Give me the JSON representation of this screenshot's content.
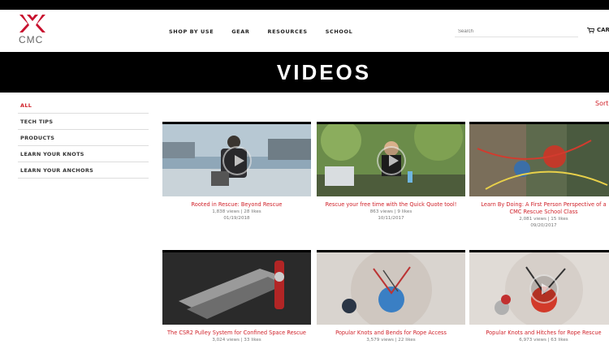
{
  "brand": {
    "logo_text": "CMC"
  },
  "nav": {
    "items": [
      "SHOP BY USE",
      "GEAR",
      "RESOURCES",
      "SCHOOL"
    ]
  },
  "search": {
    "placeholder": "Search"
  },
  "cart": {
    "label": "CART"
  },
  "banner": {
    "title": "VIDEOS"
  },
  "sidebar": {
    "items": [
      {
        "label": "ALL",
        "active": true
      },
      {
        "label": "TECH TIPS"
      },
      {
        "label": "PRODUCTS"
      },
      {
        "label": "LEARN YOUR KNOTS"
      },
      {
        "label": "LEARN YOUR ANCHORS"
      }
    ]
  },
  "sort": {
    "label": "Sort"
  },
  "videos": [
    {
      "title": "Rooted in Rescue: Beyond Rescue",
      "stats": "1,838 views | 28 likes",
      "date": "01/19/2018"
    },
    {
      "title": "Rescue your free time with the Quick Quote tool!",
      "stats": "863 views | 9 likes",
      "date": "10/11/2017"
    },
    {
      "title": "Learn By Doing: A First Person Perspective of a CMC Rescue School Class",
      "stats": "2,081 views | 15 likes",
      "date": "09/20/2017"
    },
    {
      "title": "The CSR2 Pulley System for Confined Space Rescue",
      "stats": "3,024 views | 33 likes",
      "date": ""
    },
    {
      "title": "Popular Knots and Bends for Rope Access",
      "stats": "3,579 views | 22 likes",
      "date": ""
    },
    {
      "title": "Popular Knots and Hitches for Rope Rescue",
      "stats": "6,973 views | 63 likes",
      "date": ""
    }
  ],
  "colors": {
    "accent": "#d0222a",
    "banner": "#000000"
  },
  "icons": {
    "cart": "cart-icon",
    "play": "play-icon",
    "logo": "cmc-logo-icon"
  }
}
